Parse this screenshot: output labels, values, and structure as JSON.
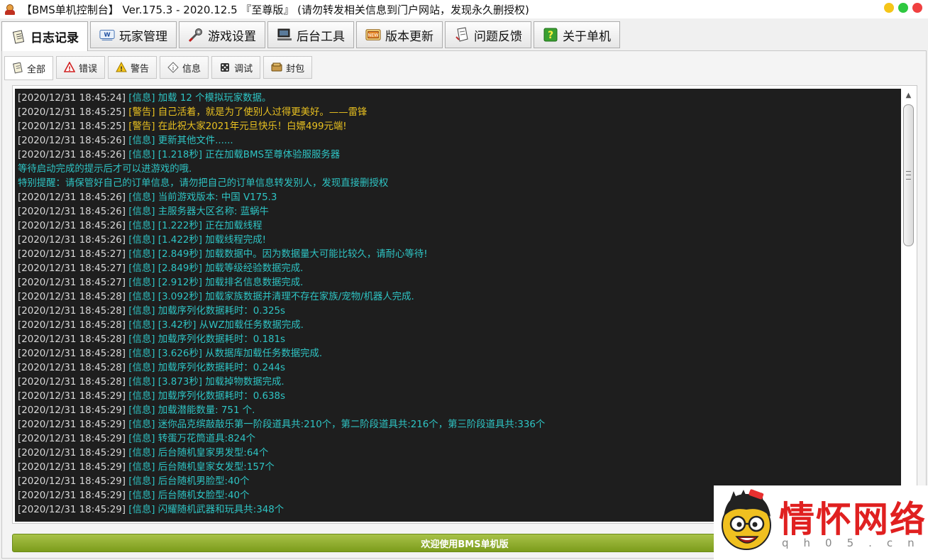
{
  "window": {
    "title": "【BMS单机控制台】 Ver.175.3 - 2020.12.5 『至尊版』 (请勿转发相关信息到门户网站，发现永久删授权)",
    "controls": [
      {
        "name": "minimize",
        "color": "#f5c518"
      },
      {
        "name": "maximize",
        "color": "#2ec840"
      },
      {
        "name": "close",
        "color": "#f04040"
      }
    ]
  },
  "main_tabs": [
    {
      "label": "日志记录",
      "icon": "notebook-icon",
      "active": true
    },
    {
      "label": "玩家管理",
      "icon": "web-user-icon",
      "active": false
    },
    {
      "label": "游戏设置",
      "icon": "wrench-icon",
      "active": false
    },
    {
      "label": "后台工具",
      "icon": "computer-icon",
      "active": false
    },
    {
      "label": "版本更新",
      "icon": "update-icon",
      "active": false
    },
    {
      "label": "问题反馈",
      "icon": "feedback-icon",
      "active": false
    },
    {
      "label": "关于单机",
      "icon": "help-icon",
      "active": false
    }
  ],
  "sub_tabs": [
    {
      "label": "全部",
      "icon": "notebook-icon",
      "active": true
    },
    {
      "label": "错误",
      "icon": "error-icon",
      "active": false
    },
    {
      "label": "警告",
      "icon": "warning-icon",
      "active": false
    },
    {
      "label": "信息",
      "icon": "info-icon",
      "active": false
    },
    {
      "label": "调试",
      "icon": "debug-icon",
      "active": false
    },
    {
      "label": "封包",
      "icon": "packet-icon",
      "active": false
    }
  ],
  "log": {
    "lines": [
      {
        "ts": "[2020/12/31 18:45:24]",
        "tag": "[信息]",
        "msg": "加载 12 个模拟玩家数据。",
        "level": "info"
      },
      {
        "ts": "[2020/12/31 18:45:25]",
        "tag": "[警告]",
        "msg": "自己活着，就是为了使别人过得更美好。——雷锋",
        "level": "warn"
      },
      {
        "ts": "[2020/12/31 18:45:25]",
        "tag": "[警告]",
        "msg": "在此祝大家2021年元旦快乐！白嫖499元端!",
        "level": "warn"
      },
      {
        "ts": "[2020/12/31 18:45:26]",
        "tag": "[信息]",
        "msg": "更新其他文件......",
        "level": "info"
      },
      {
        "ts": "[2020/12/31 18:45:26]",
        "tag": "[信息]",
        "msg": "[1.218秒] 正在加载BMS至尊体验服服务器",
        "level": "info"
      },
      {
        "ts": "",
        "tag": "",
        "msg": "等待启动完成的提示后才可以进游戏的哦.",
        "level": "plain"
      },
      {
        "ts": "",
        "tag": "",
        "msg": "特别提醒：请保管好自己的订单信息，请勿把自己的订单信息转发别人，发现直接删授权",
        "level": "plain"
      },
      {
        "ts": "[2020/12/31 18:45:26]",
        "tag": "[信息]",
        "msg": "当前游戏版本: 中国 V175.3",
        "level": "info"
      },
      {
        "ts": "[2020/12/31 18:45:26]",
        "tag": "[信息]",
        "msg": "主服务器大区名称: 蓝蜗牛",
        "level": "info"
      },
      {
        "ts": "[2020/12/31 18:45:26]",
        "tag": "[信息]",
        "msg": "[1.222秒] 正在加载线程",
        "level": "info"
      },
      {
        "ts": "[2020/12/31 18:45:26]",
        "tag": "[信息]",
        "msg": "[1.422秒] 加载线程完成!",
        "level": "info"
      },
      {
        "ts": "[2020/12/31 18:45:27]",
        "tag": "[信息]",
        "msg": "[2.849秒] 加载数据中。因为数据量大可能比较久，请耐心等待!",
        "level": "info"
      },
      {
        "ts": "[2020/12/31 18:45:27]",
        "tag": "[信息]",
        "msg": "[2.849秒] 加载等级经验数据完成.",
        "level": "info"
      },
      {
        "ts": "[2020/12/31 18:45:27]",
        "tag": "[信息]",
        "msg": "[2.912秒] 加载排名信息数据完成.",
        "level": "info"
      },
      {
        "ts": "[2020/12/31 18:45:28]",
        "tag": "[信息]",
        "msg": "[3.092秒] 加载家族数据并清理不存在家族/宠物/机器人完成.",
        "level": "info"
      },
      {
        "ts": "[2020/12/31 18:45:28]",
        "tag": "[信息]",
        "msg": "加载序列化数据耗时：0.325s",
        "level": "info"
      },
      {
        "ts": "[2020/12/31 18:45:28]",
        "tag": "[信息]",
        "msg": "[3.42秒] 从WZ加载任务数据完成.",
        "level": "info"
      },
      {
        "ts": "[2020/12/31 18:45:28]",
        "tag": "[信息]",
        "msg": "加载序列化数据耗时：0.181s",
        "level": "info"
      },
      {
        "ts": "[2020/12/31 18:45:28]",
        "tag": "[信息]",
        "msg": "[3.626秒] 从数据库加载任务数据完成.",
        "level": "info"
      },
      {
        "ts": "[2020/12/31 18:45:28]",
        "tag": "[信息]",
        "msg": "加载序列化数据耗时：0.244s",
        "level": "info"
      },
      {
        "ts": "[2020/12/31 18:45:28]",
        "tag": "[信息]",
        "msg": "[3.873秒] 加载掉物数据完成.",
        "level": "info"
      },
      {
        "ts": "[2020/12/31 18:45:29]",
        "tag": "[信息]",
        "msg": "加载序列化数据耗时：0.638s",
        "level": "info"
      },
      {
        "ts": "[2020/12/31 18:45:29]",
        "tag": "[信息]",
        "msg": "加载潜能数量: 751 个.",
        "level": "info"
      },
      {
        "ts": "[2020/12/31 18:45:29]",
        "tag": "[信息]",
        "msg": "迷你品克缤敲敲乐第一阶段道具共:210个，第二阶段道具共:216个，第三阶段道具共:336个",
        "level": "info"
      },
      {
        "ts": "[2020/12/31 18:45:29]",
        "tag": "[信息]",
        "msg": "转蛋万花筒道具:824个",
        "level": "info"
      },
      {
        "ts": "[2020/12/31 18:45:29]",
        "tag": "[信息]",
        "msg": "后台随机皇家男发型:64个",
        "level": "info"
      },
      {
        "ts": "[2020/12/31 18:45:29]",
        "tag": "[信息]",
        "msg": "后台随机皇家女发型:157个",
        "level": "info"
      },
      {
        "ts": "[2020/12/31 18:45:29]",
        "tag": "[信息]",
        "msg": "后台随机男脸型:40个",
        "level": "info"
      },
      {
        "ts": "[2020/12/31 18:45:29]",
        "tag": "[信息]",
        "msg": "后台随机女脸型:40个",
        "level": "info"
      },
      {
        "ts": "[2020/12/31 18:45:29]",
        "tag": "[信息]",
        "msg": "闪耀随机武器和玩具共:348个",
        "level": "info"
      }
    ]
  },
  "statusbar": {
    "text": "欢迎使用BMS单机版"
  },
  "watermark": {
    "brand": "情怀网络",
    "site": "qh05.cn",
    "mascot_icon": "cartoon-face-icon"
  }
}
